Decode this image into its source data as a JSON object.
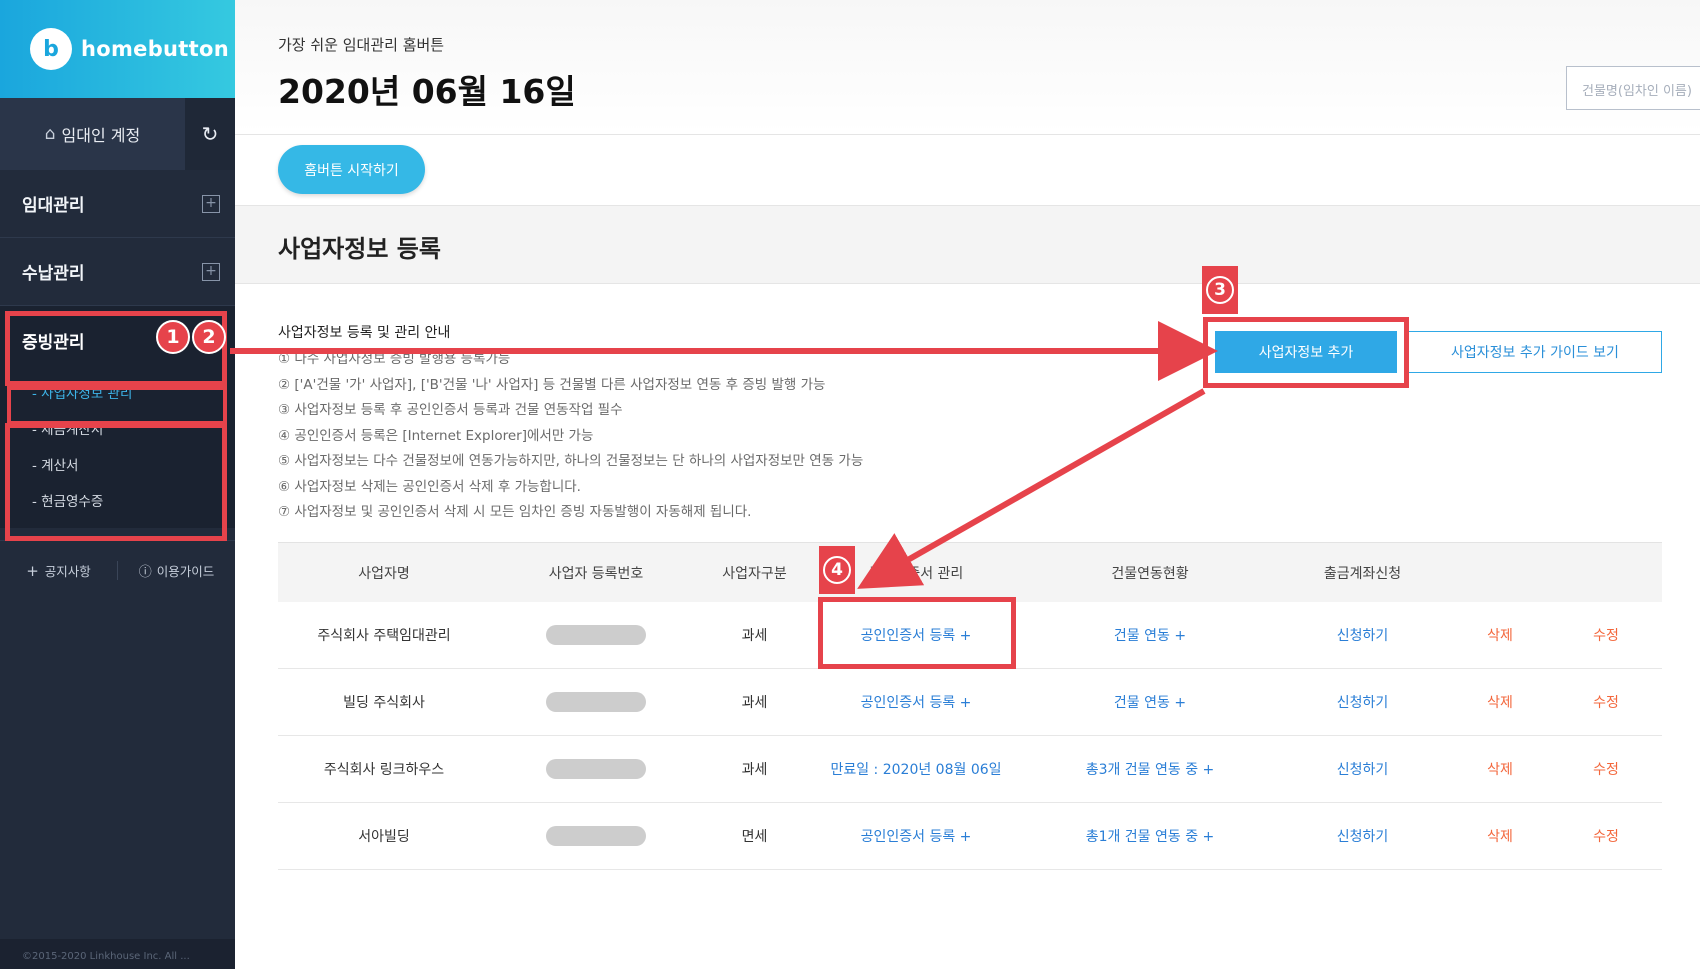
{
  "brand": {
    "name": "homebutton",
    "logo_letter": "b"
  },
  "sidebar": {
    "account_label": "임대인 계정",
    "nav": [
      {
        "label": "임대관리"
      },
      {
        "label": "수납관리"
      }
    ],
    "active_nav": "증빙관리",
    "sub_items": [
      {
        "label": "- 사업자정보 관리"
      },
      {
        "label": "- 세금계산서"
      },
      {
        "label": "- 계산서"
      },
      {
        "label": "- 현금영수증"
      }
    ],
    "links": [
      {
        "label": "공지사항"
      },
      {
        "label": "이용가이드"
      }
    ],
    "footer": "©2015-2020 Linkhouse Inc. All ..."
  },
  "header": {
    "tagline": "가장 쉬운 임대관리 홈버튼",
    "date": "2020년 06월 16일",
    "search_placeholder": "건물명(임차인 이름)"
  },
  "start_button": "홈버튼 시작하기",
  "section_title": "사업자정보 등록",
  "guide": {
    "title": "사업자정보 등록 및 관리 안내",
    "lines": [
      "① 다수 사업자정보 증빙 발행용 등록가능",
      "② ['A'건물 '가' 사업자], ['B'건물 '나' 사업자] 등 건물별 다른 사업자정보 연동 후 증빙 발행 가능",
      "③ 사업자정보 등록 후 공인인증서 등록과 건물 연동작업 필수",
      "④ 공인인증서 등록은 [Internet Explorer]에서만 가능",
      "⑤ 사업자정보는 다수 건물정보에 연동가능하지만, 하나의 건물정보는 단 하나의 사업자정보만 연동 가능",
      "⑥ 사업자정보 삭제는 공인인증서 삭제 후 가능합니다.",
      "⑦ 사업자정보 및 공인인증서 삭제 시 모든 임차인 증빙 자동발행이 자동해제 됩니다."
    ]
  },
  "buttons": {
    "add_business": "사업자정보 추가",
    "add_guide": "사업자정보 추가 가이드 보기"
  },
  "table": {
    "headers": [
      "사업자명",
      "사업자 등록번호",
      "사업자구분",
      "공인인증서 관리",
      "건물연동현황",
      "출금계좌신청",
      "",
      ""
    ],
    "rows": [
      {
        "name": "주식회사 주택임대관리",
        "type": "과세",
        "cert": "공인인증서 등록 +",
        "building": "건물 연동 +",
        "account": "신청하기",
        "delete": "삭제",
        "edit": "수정"
      },
      {
        "name": "빌딩 주식회사",
        "type": "과세",
        "cert": "공인인증서 등록 +",
        "building": "건물 연동 +",
        "account": "신청하기",
        "delete": "삭제",
        "edit": "수정"
      },
      {
        "name": "주식회사 링크하우스",
        "type": "과세",
        "cert": "만료일 : 2020년 08월 06일",
        "building": "총3개 건물 연동 중 +",
        "account": "신청하기",
        "delete": "삭제",
        "edit": "수정"
      },
      {
        "name": "서아빌딩",
        "type": "면세",
        "cert": "공인인증서 등록 +",
        "building": "총1개 건물 연동 중 +",
        "account": "신청하기",
        "delete": "삭제",
        "edit": "수정"
      }
    ]
  },
  "annotations": {
    "badges": [
      "1",
      "2",
      "3",
      "4"
    ],
    "color": "#e6434b"
  }
}
